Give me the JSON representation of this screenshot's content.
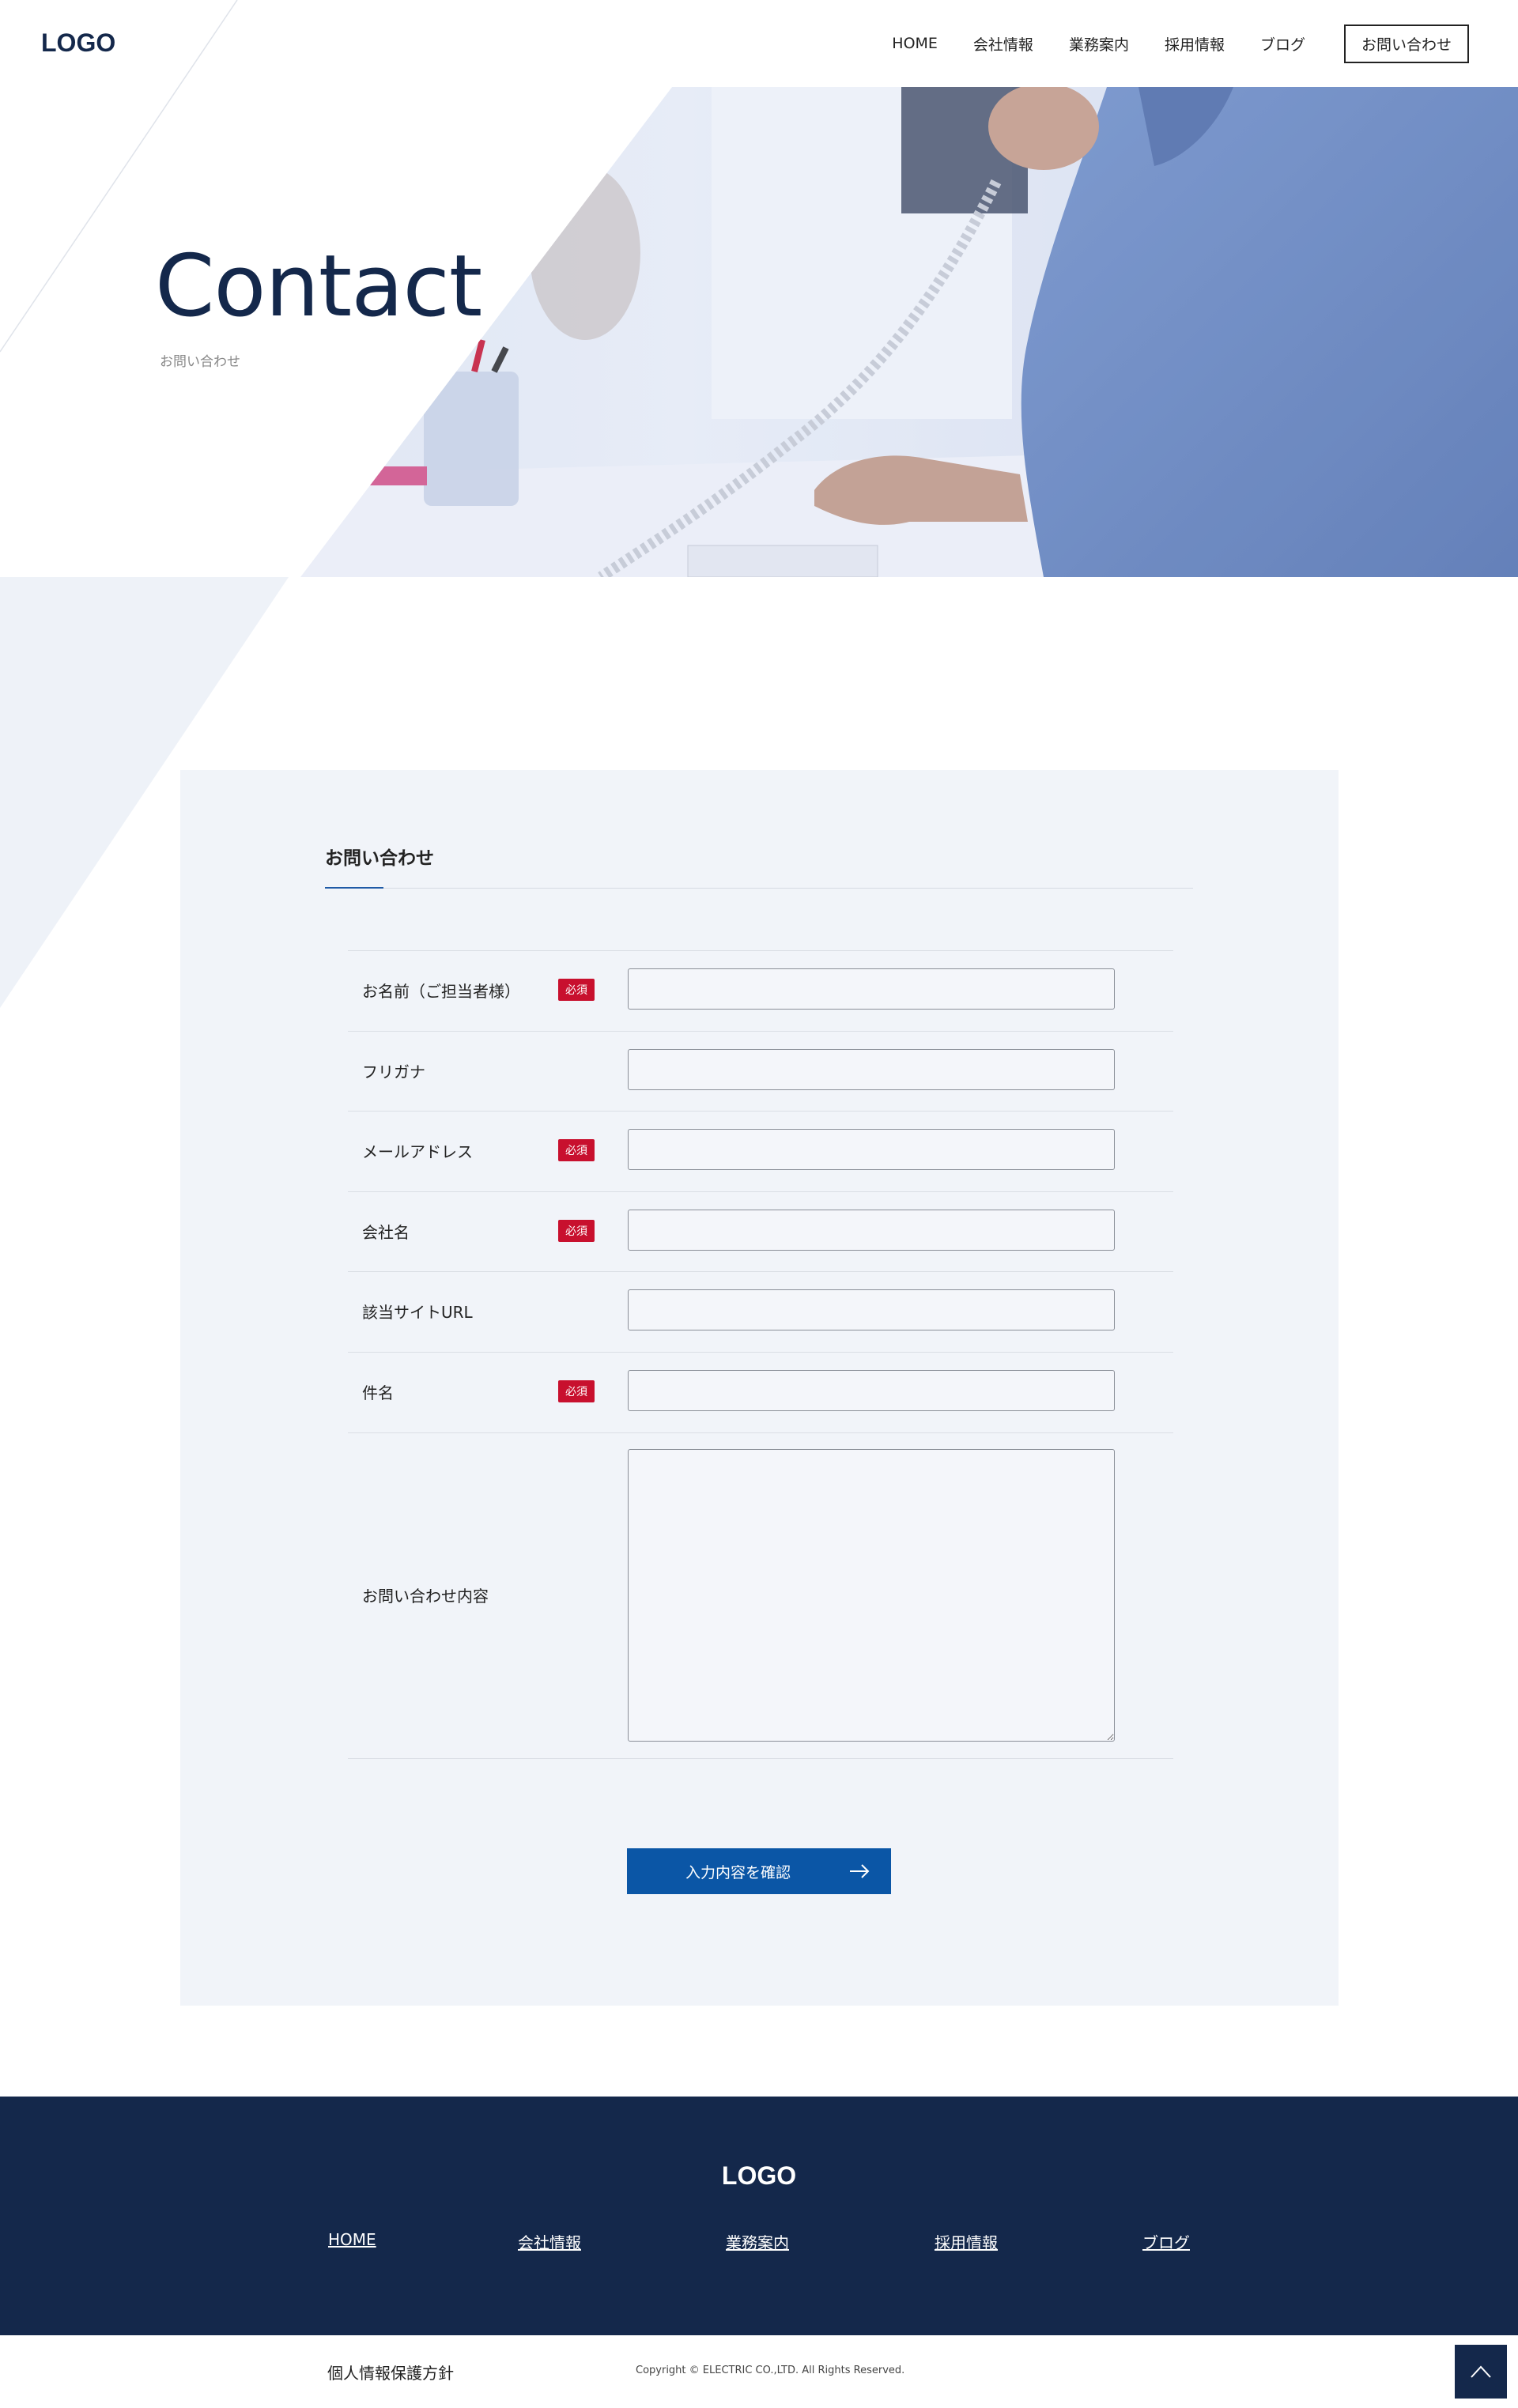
{
  "header": {
    "logo": "LOGO",
    "nav": [
      "HOME",
      "会社情報",
      "業務案内",
      "採用情報",
      "ブログ"
    ],
    "contact_button": "お問い合わせ"
  },
  "hero": {
    "title": "Contact",
    "subtitle": "お問い合わせ"
  },
  "form": {
    "heading": "お問い合わせ",
    "required_label": "必須",
    "fields": [
      {
        "label": "お名前（ご担当者様）",
        "required": true,
        "value": ""
      },
      {
        "label": "フリガナ",
        "required": false,
        "value": ""
      },
      {
        "label": "メールアドレス",
        "required": true,
        "value": ""
      },
      {
        "label": "会社名",
        "required": true,
        "value": ""
      },
      {
        "label": "該当サイトURL",
        "required": false,
        "value": ""
      },
      {
        "label": "件名",
        "required": true,
        "value": ""
      }
    ],
    "message_label": "お問い合わせ内容",
    "message_value": "",
    "submit_label": "入力内容を確認"
  },
  "footer": {
    "logo": "LOGO",
    "links": [
      "HOME",
      "会社情報",
      "業務案内",
      "採用情報",
      "ブログ"
    ],
    "privacy": "個人情報保護方針",
    "copyright": "Copyright © ELECTRIC CO.,LTD. All Rights Reserved."
  },
  "colors": {
    "navy": "#14284b",
    "accent_blue": "#0b56a6",
    "required_red": "#c8102e",
    "panel_bg": "#f1f4f9"
  },
  "icons": [
    "arrow-right-icon",
    "chevron-up-icon"
  ]
}
